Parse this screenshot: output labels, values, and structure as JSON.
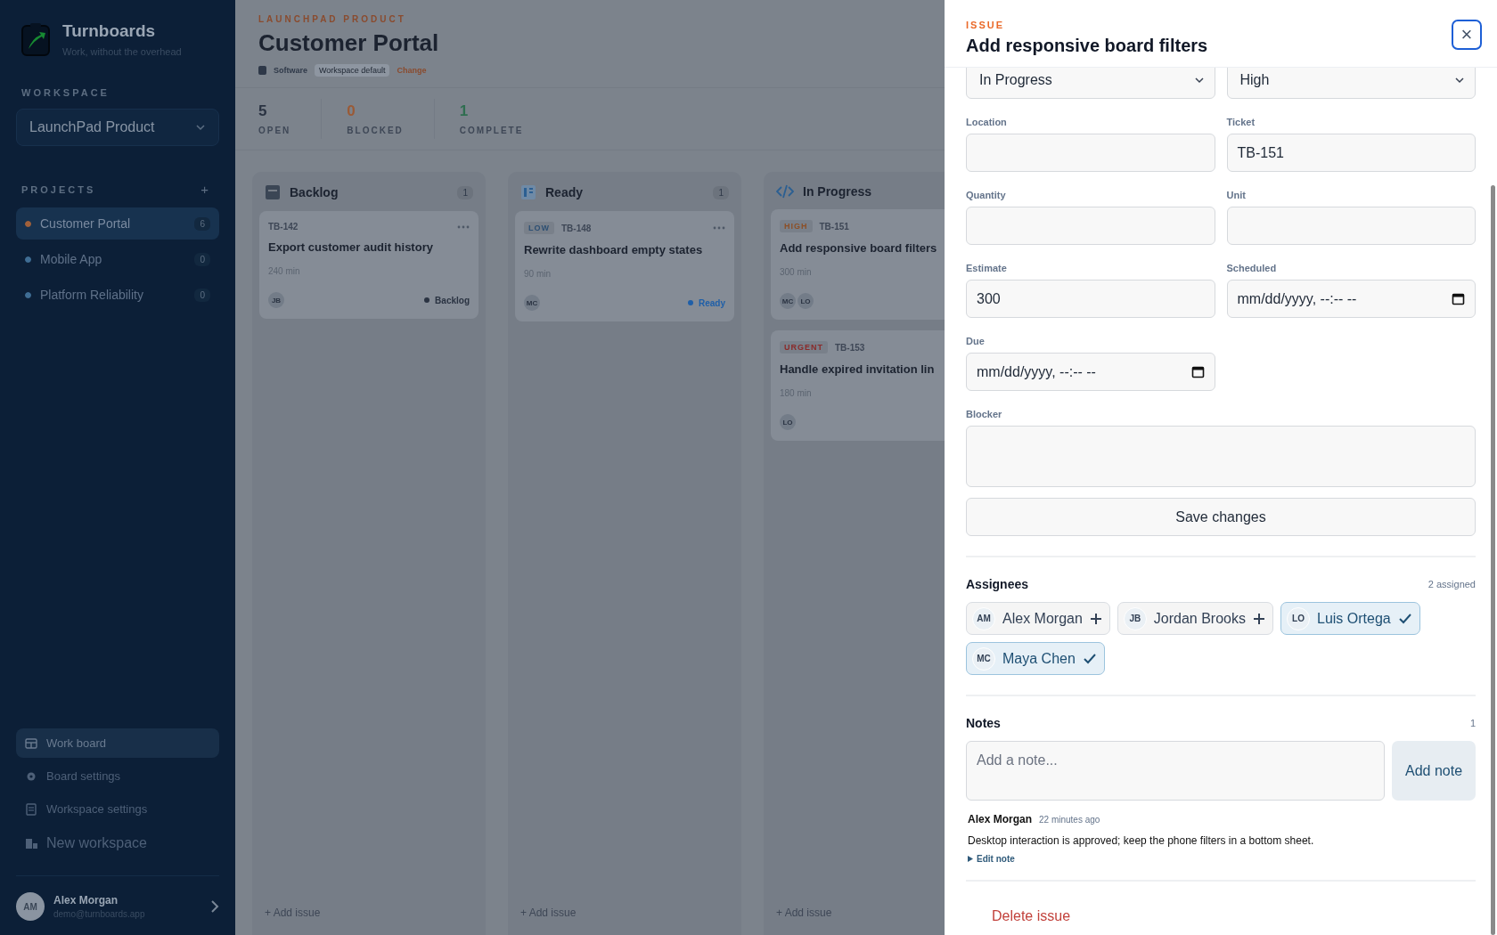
{
  "sidebar": {
    "brand": {
      "name": "Turnboards",
      "tagline": "Work, without the overhead"
    },
    "workspace_label": "WORKSPACE",
    "workspace_select": "LaunchPad Product",
    "projects_label": "PROJECTS",
    "add_project": "+",
    "projects": [
      {
        "name": "Customer Portal",
        "count": "6",
        "color": "#a0603a",
        "selected": true
      },
      {
        "name": "Mobile App",
        "count": "0",
        "color": "#3f6d94",
        "selected": false
      },
      {
        "name": "Platform Reliability",
        "count": "0",
        "color": "#3f6d94",
        "selected": false
      }
    ],
    "nav": [
      {
        "label": "Work board",
        "selected": true,
        "kind": "small"
      },
      {
        "label": "Board settings",
        "selected": false,
        "kind": "small"
      },
      {
        "label": "Workspace settings",
        "selected": false,
        "kind": "small"
      },
      {
        "label": "New workspace",
        "selected": false,
        "kind": "large"
      }
    ],
    "user": {
      "initials": "AM",
      "name": "Alex Morgan",
      "email": "demo@turnboards.app"
    }
  },
  "header": {
    "eyebrow": "LAUNCHPAD PRODUCT",
    "title": "Customer Portal",
    "type": "Software",
    "badge": "Workspace default",
    "change": "Change"
  },
  "stats": [
    {
      "value": "5",
      "label": "OPEN",
      "color": "#2a3342"
    },
    {
      "value": "0",
      "label": "BLOCKED",
      "color": "#9a5a36"
    },
    {
      "value": "1",
      "label": "COMPLETE",
      "color": "#2f6e50"
    }
  ],
  "columns": [
    {
      "title": "Backlog",
      "count": "1",
      "add": "+ Add issue",
      "cards": [
        {
          "id": "TB-142",
          "title": "Export customer audit history",
          "estimate": "240 min",
          "assignees": [
            "JB"
          ],
          "status": {
            "label": "Backlog",
            "color": "#2a3342"
          }
        }
      ]
    },
    {
      "title": "Ready",
      "count": "1",
      "add": "+ Add issue",
      "cards": [
        {
          "tag": {
            "label": "LOW",
            "color": "#2d4f73"
          },
          "id": "TB-148",
          "title": "Rewrite dashboard empty states",
          "estimate": "90 min",
          "assignees": [
            "MC"
          ],
          "status": {
            "label": "Ready",
            "color": "#1f5fa8"
          }
        }
      ]
    },
    {
      "title": "In Progress",
      "add": "+ Add issue",
      "cards": [
        {
          "tag": {
            "label": "HIGH",
            "color": "#8c4f26"
          },
          "id": "TB-151",
          "title": "Add responsive board filters",
          "estimate": "300 min",
          "assignees": [
            "MC",
            "LO"
          ]
        },
        {
          "tag": {
            "label": "URGENT",
            "color": "#8a2a2a"
          },
          "id": "TB-153",
          "title": "Handle expired invitation lin",
          "estimate": "180 min",
          "assignees": [
            "LO"
          ]
        }
      ]
    }
  ],
  "drawer": {
    "eyebrow": "ISSUE",
    "title": "Add responsive board filters",
    "close": "×",
    "fields": [
      {
        "kind": "select",
        "value": "In Progress"
      },
      {
        "kind": "select",
        "value": "High"
      },
      {
        "kind": "text",
        "label": "Location"
      },
      {
        "kind": "text",
        "label": "Ticket",
        "value": "TB-151"
      },
      {
        "kind": "text",
        "label": "Quantity"
      },
      {
        "kind": "text",
        "label": "Unit"
      },
      {
        "kind": "text",
        "label": "Estimate",
        "value": "300"
      },
      {
        "kind": "date",
        "label": "Scheduled",
        "placeholder": "mm/dd/yyyy, --:-- --"
      },
      {
        "kind": "date",
        "label": "Due",
        "placeholder": "mm/dd/yyyy, --:-- --"
      },
      {
        "kind": "textarea",
        "label": "Blocker"
      }
    ],
    "save": "Save changes",
    "assignees": {
      "title": "Assignees",
      "count": "2 assigned",
      "people": [
        {
          "initials": "AM",
          "name": "Alex Morgan",
          "selected": false
        },
        {
          "initials": "JB",
          "name": "Jordan Brooks",
          "selected": false
        },
        {
          "initials": "LO",
          "name": "Luis Ortega",
          "selected": true
        },
        {
          "initials": "MC",
          "name": "Maya Chen",
          "selected": true
        }
      ]
    },
    "notes": {
      "title": "Notes",
      "count": "1",
      "placeholder": "Add a note...",
      "add": "Add note",
      "items": [
        {
          "author": "Alex Morgan",
          "time": "22 minutes ago",
          "text": "Desktop interaction is approved; keep the phone filters in a bottom sheet.",
          "edit": "Edit note"
        }
      ]
    },
    "delete": "Delete issue"
  }
}
